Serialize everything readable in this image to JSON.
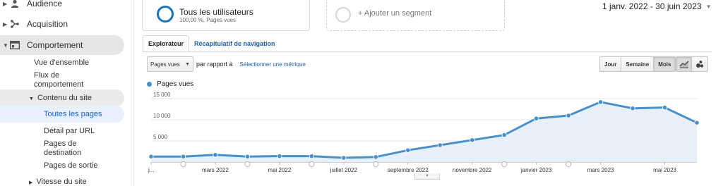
{
  "sidebar": {
    "items": [
      {
        "label": "Audience",
        "icon": "person-icon"
      },
      {
        "label": "Acquisition",
        "icon": "acquisition-icon"
      },
      {
        "label": "Comportement",
        "icon": "behavior-icon"
      }
    ],
    "behavior_sub": [
      {
        "label": "Vue d'ensemble"
      },
      {
        "label": "Flux de comportement"
      },
      {
        "label": "Contenu du site"
      },
      {
        "label": "Toutes les pages"
      },
      {
        "label": "Détail par URL"
      },
      {
        "label": "Pages de destination"
      },
      {
        "label": "Pages de sortie"
      },
      {
        "label": "Vitesse du site"
      }
    ]
  },
  "segments": {
    "all_users_title": "Tous les utilisateurs",
    "all_users_sub": "100,00 %, Pages vues",
    "add_segment": "+ Ajouter un segment"
  },
  "date_range": "1 janv. 2022 - 30 juin 2023",
  "tabs": {
    "explorer": "Explorateur",
    "navigation_summary": "Récapitulatif de navigation"
  },
  "controls": {
    "metric_selected": "Pages vues",
    "compare_label": "par rapport à",
    "select_metric": "Sélectionner une métrique",
    "period_day": "Jour",
    "period_week": "Semaine",
    "period_month": "Mois"
  },
  "colors": {
    "accent": "#4a90c8",
    "fill": "#e7f0f9",
    "link": "#1a5fa8",
    "selected_nav": "#1967d2"
  },
  "chart_data": {
    "type": "area",
    "series": [
      {
        "name": "Pages vues",
        "x": [
          "2022-01",
          "2022-02",
          "2022-03",
          "2022-04",
          "2022-05",
          "2022-06",
          "2022-07",
          "2022-08",
          "2022-09",
          "2022-10",
          "2022-11",
          "2022-12",
          "2023-01",
          "2023-02",
          "2023-03",
          "2023-04",
          "2023-05",
          "2023-06"
        ],
        "values": [
          1300,
          1300,
          1700,
          1300,
          1400,
          1400,
          1000,
          1200,
          2800,
          4000,
          5200,
          6400,
          10300,
          11000,
          14200,
          12700,
          12900,
          9300
        ]
      }
    ],
    "y_ticks": [
      "15 000",
      "10 000",
      "5 000"
    ],
    "ylim": [
      0,
      17000
    ],
    "x_labels": [
      {
        "x": "2022-01",
        "label": "j..."
      },
      {
        "x": "2022-03",
        "label": "mars 2022"
      },
      {
        "x": "2022-05",
        "label": "mai 2022"
      },
      {
        "x": "2022-07",
        "label": "juillet 2022"
      },
      {
        "x": "2022-09",
        "label": "septembre 2022"
      },
      {
        "x": "2022-11",
        "label": "novembre 2022"
      },
      {
        "x": "2023-01",
        "label": "janvier 2023"
      },
      {
        "x": "2023-03",
        "label": "mars 2023"
      },
      {
        "x": "2023-05",
        "label": "mai 2023"
      }
    ],
    "annotation_months": [
      "2022-02",
      "2022-04",
      "2022-06",
      "2022-08",
      "2022-12",
      "2023-02"
    ],
    "grid": true
  }
}
